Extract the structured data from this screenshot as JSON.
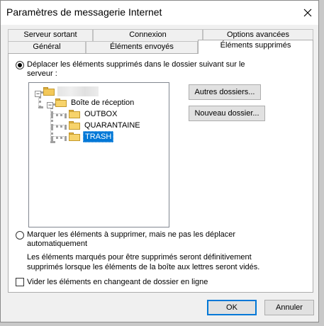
{
  "window": {
    "title": "Paramètres de messagerie Internet"
  },
  "tabs": {
    "back": [
      "Serveur sortant",
      "Connexion",
      "Options avancées"
    ],
    "front": [
      "Général",
      "Éléments envoyés",
      "Éléments supprimés"
    ]
  },
  "options": {
    "move_label_line1": "Déplacer les éléments supprimés dans le dossier suivant sur le",
    "move_label_line2": "serveur :",
    "mark_label_line1": "Marquer les éléments à supprimer, mais ne pas les déplacer",
    "mark_label_line2": "automatiquement",
    "mark_desc_line1": "Les éléments marqués pour être supprimés seront définitivement",
    "mark_desc_line2": "supprimés lorsque les éléments de la boîte aux lettres seront vidés.",
    "purge_label": "Vider les éléments en changeant de dossier en ligne",
    "move_selected": true,
    "mark_selected": false,
    "purge_checked": false
  },
  "tree": {
    "inbox": "Boîte de réception",
    "folders": [
      "OUTBOX",
      "QUARANTAINE",
      "TRASH"
    ],
    "selected": "TRASH"
  },
  "buttons": {
    "other_folders": "Autres dossiers...",
    "new_folder": "Nouveau dossier...",
    "ok": "OK",
    "cancel": "Annuler"
  },
  "icons": {
    "close": "close-icon",
    "folder": "folder-icon",
    "mailbox": "mailbox-icon"
  },
  "colors": {
    "selection": "#0078d7",
    "folder": "#f7d36b"
  }
}
